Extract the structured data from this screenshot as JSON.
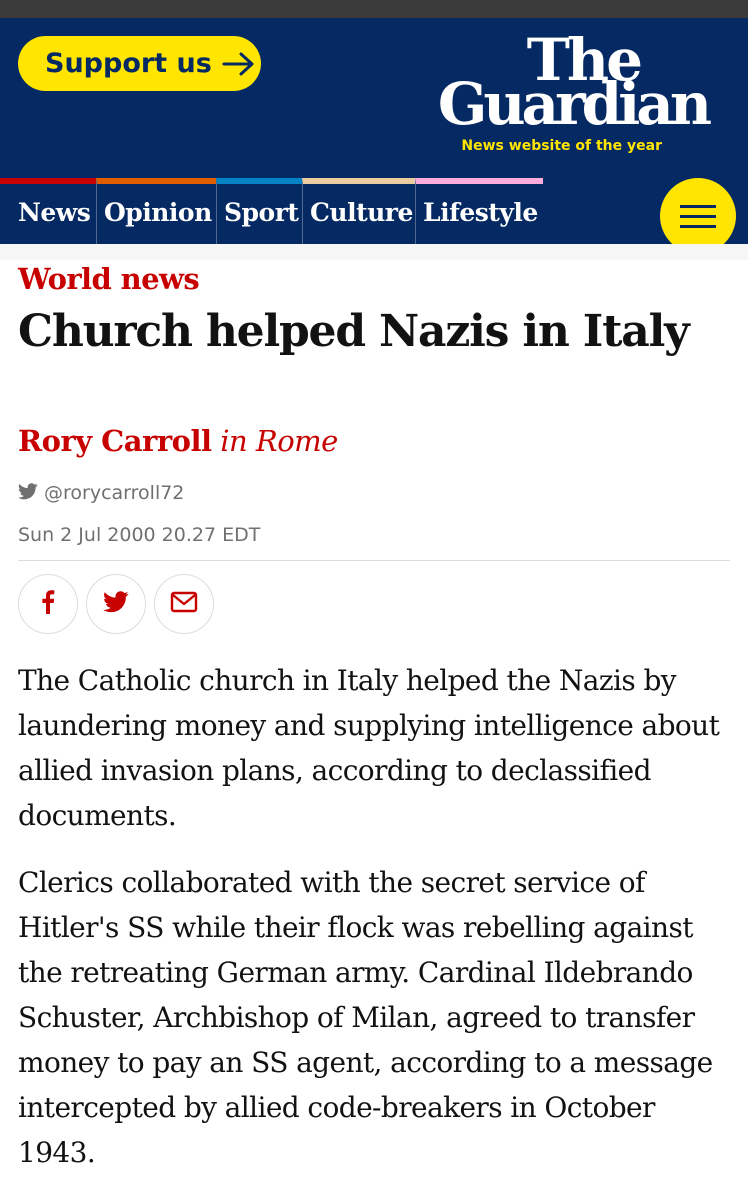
{
  "masthead": {
    "support_label": "Support us",
    "logo_line1": "The",
    "logo_line2": "Guardian",
    "logo_tagline": "News website of the year"
  },
  "nav": {
    "items": [
      {
        "label": "News",
        "color": "#c70000"
      },
      {
        "label": "Opinion",
        "color": "#e05e00"
      },
      {
        "label": "Sport",
        "color": "#0084c6"
      },
      {
        "label": "Culture",
        "color": "#a1845c"
      },
      {
        "label": "Lifestyle",
        "color": "#bb3b80"
      }
    ],
    "menu_icon": "hamburger-icon"
  },
  "article": {
    "section": "World news",
    "headline": "Church helped Nazis in Italy",
    "author": "Rory Carroll",
    "location": "in Rome",
    "twitter_handle": "@rorycarroll72",
    "date": "Sun 2 Jul 2000 20.27 EDT",
    "share_icons": [
      "facebook-icon",
      "twitter-icon",
      "email-icon"
    ],
    "paragraphs": [
      "The Catholic church in Italy helped the Nazis by laundering money and supplying intelligence about allied invasion plans, according to declassified documents.",
      "Clerics collaborated with the secret service of Hitler's SS while their flock was rebelling against the retreating German army. Cardinal Ildebrando Schuster, Archbishop of Milan, agreed to transfer money to pay an SS agent, according to a message intercepted by allied code-breakers in October 1943."
    ]
  },
  "colors": {
    "brand_blue": "#052962",
    "brand_yellow": "#ffe500",
    "news_red": "#c70000"
  }
}
